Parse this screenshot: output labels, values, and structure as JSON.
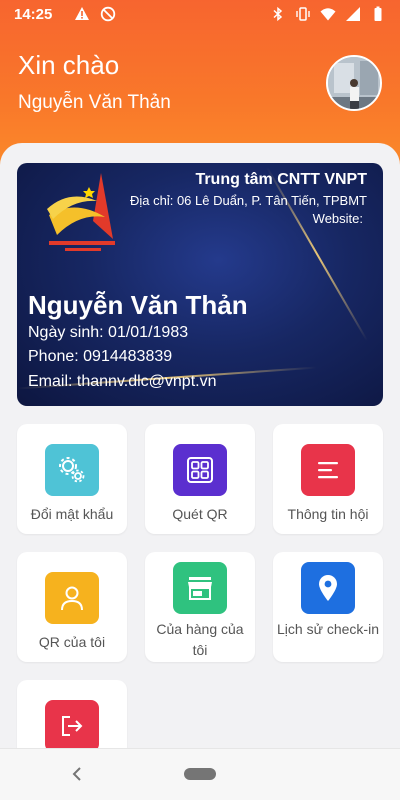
{
  "status_bar": {
    "time": "14:25"
  },
  "header": {
    "greeting": "Xin chào",
    "user_name": "Nguyễn Văn Thản"
  },
  "card": {
    "organization": "Trung tâm CNTT VNPT",
    "address": "Địa chỉ: 06 Lê Duẩn, P. Tân Tiến, TPBMT",
    "website": "Website:",
    "name": "Nguyễn Văn Thản",
    "dob": "Ngày sinh: 01/01/1983",
    "phone": "Phone: 0914483839",
    "email": "Email: thannv.dlc@vnpt.vn"
  },
  "menu": [
    {
      "label": "Đổi mật khẩu",
      "icon": "gears-icon",
      "color": "#4fc3d6"
    },
    {
      "label": "Quét QR",
      "icon": "qr-grid-icon",
      "color": "#5b2fcf"
    },
    {
      "label": "Thông tin hội",
      "icon": "text-lines-icon",
      "color": "#e8344a"
    },
    {
      "label": "QR của tôi",
      "icon": "user-icon",
      "color": "#f6b21e"
    },
    {
      "label": "Của hàng của tôi",
      "icon": "store-icon",
      "color": "#2fc27f"
    },
    {
      "label": "Lịch sử check-in",
      "icon": "location-pin-icon",
      "color": "#1e6fe0"
    },
    {
      "label": "",
      "icon": "logout-icon",
      "color": "#e8344a"
    }
  ],
  "colors": {
    "header_orange": "#f7652f",
    "card_navy": "#172763"
  }
}
